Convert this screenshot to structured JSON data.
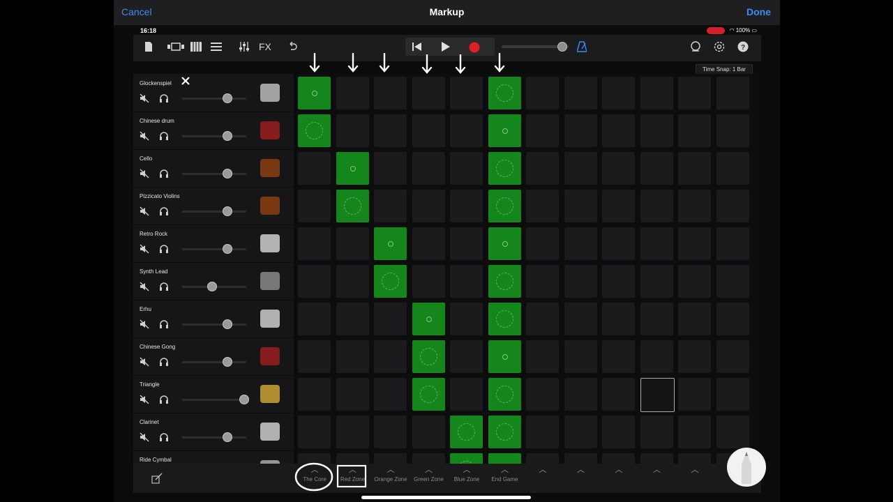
{
  "markup_bar": {
    "cancel": "Cancel",
    "title": "Markup",
    "done": "Done"
  },
  "status": {
    "time": "16:18",
    "battery": "100%"
  },
  "toolbar": {
    "fx_label": "FX",
    "time_snap": "Time Snap: 1 Bar"
  },
  "tracks": [
    {
      "name": "Glockenspiel",
      "icon": "glockenspiel-icon",
      "volume": 0.7
    },
    {
      "name": "Chinese drum",
      "icon": "chinese-drum-icon",
      "volume": 0.7
    },
    {
      "name": "Cello",
      "icon": "cello-icon",
      "volume": 0.7
    },
    {
      "name": "Pizzicato Violins",
      "icon": "violins-icon",
      "volume": 0.7
    },
    {
      "name": "Retro Rock",
      "icon": "drum-kit-icon",
      "volume": 0.7
    },
    {
      "name": "Synth Lead",
      "icon": "synth-icon",
      "volume": 0.46
    },
    {
      "name": "Erhu",
      "icon": "erhu-icon",
      "volume": 0.7
    },
    {
      "name": "Chinese Gong",
      "icon": "gong-icon",
      "volume": 0.7
    },
    {
      "name": "Triangle",
      "icon": "triangle-icon",
      "volume": 0.96
    },
    {
      "name": "Clarinet",
      "icon": "clarinet-icon",
      "volume": 0.7
    },
    {
      "name": "Ride Cymbal",
      "icon": "cymbal-icon",
      "volume": 0.7
    }
  ],
  "zones": [
    "The Core",
    "Red Zone",
    "Orange Zone",
    "Green Zone",
    "Blue Zone",
    "End Game",
    "",
    "",
    "",
    "",
    ""
  ],
  "active_cells": [
    [
      0,
      0
    ],
    [
      0,
      5
    ],
    [
      1,
      0
    ],
    [
      1,
      5
    ],
    [
      2,
      1
    ],
    [
      2,
      5
    ],
    [
      3,
      1
    ],
    [
      3,
      5
    ],
    [
      4,
      2
    ],
    [
      4,
      5
    ],
    [
      5,
      2
    ],
    [
      5,
      5
    ],
    [
      6,
      3
    ],
    [
      6,
      5
    ],
    [
      7,
      3
    ],
    [
      7,
      5
    ],
    [
      8,
      3
    ],
    [
      8,
      5
    ],
    [
      9,
      4
    ],
    [
      9,
      5
    ],
    [
      10,
      4
    ],
    [
      10,
      5
    ]
  ],
  "selected_cell": [
    8,
    9
  ],
  "colors": {
    "accent": "#3b8bf5",
    "cell_on": "#14861b",
    "record": "#e01e25"
  }
}
